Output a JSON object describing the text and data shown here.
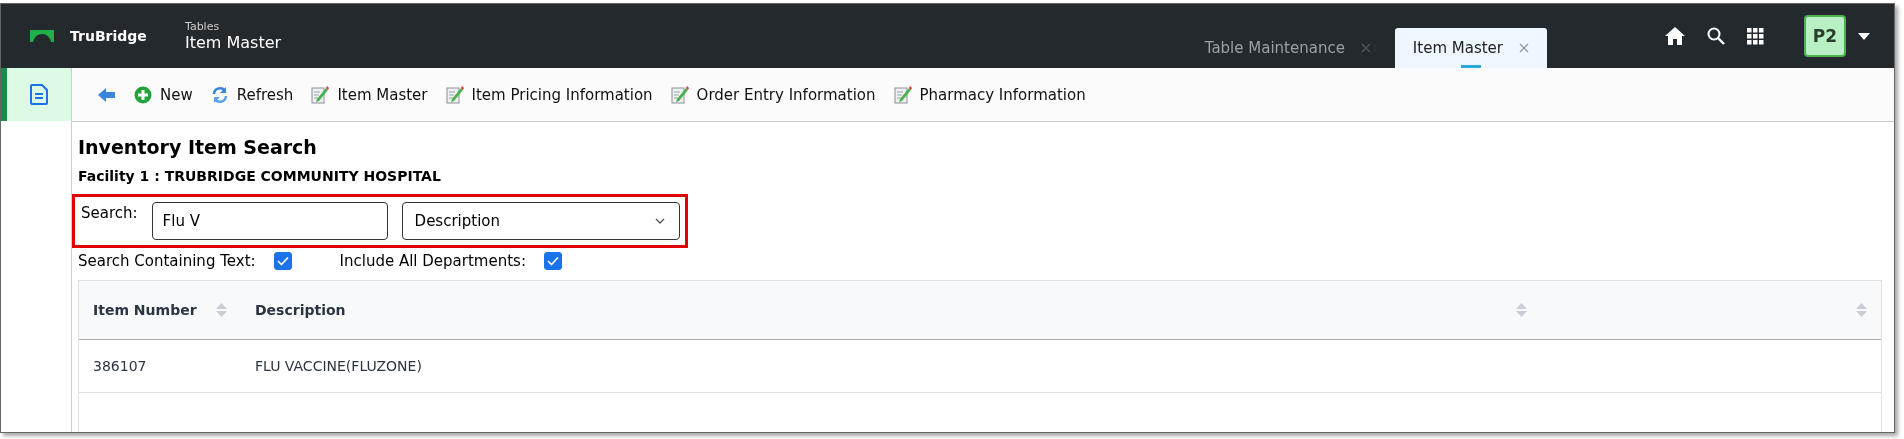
{
  "header": {
    "brand": "TruBridge",
    "section": "Tables",
    "title": "Item Master",
    "avatar": "P2"
  },
  "tabs": [
    {
      "label": "Table Maintenance",
      "selected": false
    },
    {
      "label": "Item Master",
      "selected": true
    }
  ],
  "sidebar": {
    "items": [
      {
        "kind": "document",
        "selected": true
      }
    ]
  },
  "toolbar": [
    {
      "kind": "back"
    },
    {
      "kind": "new",
      "label": "New"
    },
    {
      "kind": "refresh",
      "label": "Refresh"
    },
    {
      "kind": "edit",
      "label": "Item Master"
    },
    {
      "kind": "edit",
      "label": "Item Pricing Information"
    },
    {
      "kind": "edit",
      "label": "Order Entry Information"
    },
    {
      "kind": "edit",
      "label": "Pharmacy Information"
    }
  ],
  "page": {
    "title": "Inventory Item Search",
    "facility": "Facility 1 : TRUBRIDGE COMMUNITY HOSPITAL"
  },
  "search": {
    "label": "Search:",
    "value": "Flu V",
    "search_by": "Description",
    "highlighted": true
  },
  "options": [
    {
      "label": "Search Containing Text:",
      "checked": true
    },
    {
      "label": "Include All Departments:",
      "checked": true
    }
  ],
  "table": {
    "columns": [
      {
        "label": "Item Number",
        "sortable": true
      },
      {
        "label": "Description",
        "sortable": true
      },
      {
        "sortable": true
      }
    ],
    "rows": [
      {
        "cells": [
          "386107",
          "FLU VACCINE(FLUZONE)"
        ]
      }
    ]
  }
}
